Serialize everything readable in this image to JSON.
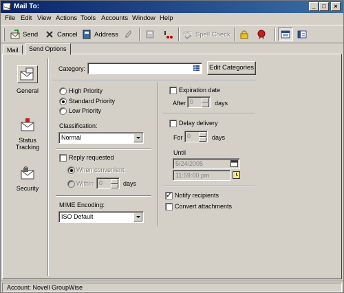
{
  "window": {
    "title": "Mail To:"
  },
  "menu": [
    "File",
    "Edit",
    "View",
    "Actions",
    "Tools",
    "Accounts",
    "Window",
    "Help"
  ],
  "toolbar": {
    "send": "Send",
    "cancel": "Cancel",
    "address": "Address",
    "spell_check": "Spell Check"
  },
  "tabs": [
    "Mail",
    "Send Options"
  ],
  "sidebar": {
    "general": "General",
    "status_tracking": "Status Tracking",
    "security": "Security"
  },
  "form": {
    "category_label": "Category:",
    "category_value": "",
    "edit_categories": "Edit Categories",
    "priority": {
      "high": "High Priority",
      "standard": "Standard Priority",
      "low": "Low Priority",
      "selected": "standard"
    },
    "classification_label": "Classification:",
    "classification_value": "Normal",
    "reply_requested": "Reply requested",
    "when_convenient": "When convenient",
    "within": "Within",
    "within_value": "0",
    "days": "days",
    "mime_label": "MIME Encoding:",
    "mime_value": "ISO Default",
    "expiration_date": "Expiration date",
    "after": "After",
    "after_value": "0",
    "delay_delivery": "Delay delivery",
    "for": "For",
    "for_value": "0",
    "until": "Until",
    "until_date": "5/24/2005",
    "until_time": "11:59:00 pm",
    "notify_recipients": "Notify recipients",
    "notify_checked": true,
    "convert_attachments": "Convert attachments"
  },
  "status": {
    "account": "Account: Novell GroupWise"
  }
}
